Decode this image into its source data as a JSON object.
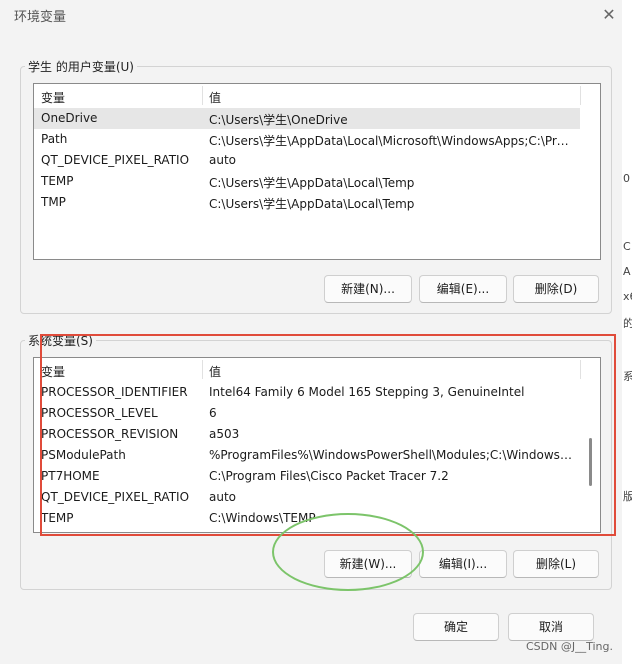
{
  "window": {
    "title": "环境变量",
    "close_glyph": "✕"
  },
  "user_vars": {
    "group_label": "学生 的用户变量(U)",
    "col_name": "变量",
    "col_value": "值",
    "rows": [
      {
        "name": "OneDrive",
        "value": "C:\\Users\\学生\\OneDrive",
        "selected": true
      },
      {
        "name": "Path",
        "value": "C:\\Users\\学生\\AppData\\Local\\Microsoft\\WindowsApps;C:\\Pro..."
      },
      {
        "name": "QT_DEVICE_PIXEL_RATIO",
        "value": "auto"
      },
      {
        "name": "TEMP",
        "value": "C:\\Users\\学生\\AppData\\Local\\Temp"
      },
      {
        "name": "TMP",
        "value": "C:\\Users\\学生\\AppData\\Local\\Temp"
      }
    ],
    "buttons": {
      "new": "新建(N)...",
      "edit": "编辑(E)...",
      "delete": "删除(D)"
    }
  },
  "sys_vars": {
    "group_label": "系统变量(S)",
    "col_name": "变量",
    "col_value": "值",
    "rows": [
      {
        "name": "PROCESSOR_IDENTIFIER",
        "value": "Intel64 Family 6 Model 165 Stepping 3, GenuineIntel"
      },
      {
        "name": "PROCESSOR_LEVEL",
        "value": "6"
      },
      {
        "name": "PROCESSOR_REVISION",
        "value": "a503"
      },
      {
        "name": "PSModulePath",
        "value": "%ProgramFiles%\\WindowsPowerShell\\Modules;C:\\Windows\\..."
      },
      {
        "name": "PT7HOME",
        "value": "C:\\Program Files\\Cisco Packet Tracer 7.2"
      },
      {
        "name": "QT_DEVICE_PIXEL_RATIO",
        "value": "auto"
      },
      {
        "name": "TEMP",
        "value": "C:\\Windows\\TEMP"
      }
    ],
    "buttons": {
      "new": "新建(W)...",
      "edit": "编辑(I)...",
      "delete": "删除(L)"
    }
  },
  "dialog_buttons": {
    "ok": "确定",
    "cancel": "取消"
  },
  "edge_fragments": [
    "0",
    "C",
    "A",
    "x6",
    "的",
    "系",
    "版"
  ],
  "watermark": "CSDN @J__Ting.",
  "colors": {
    "annotation_rect": "#e04b3a",
    "annotation_ellipse": "#7cc46a"
  }
}
